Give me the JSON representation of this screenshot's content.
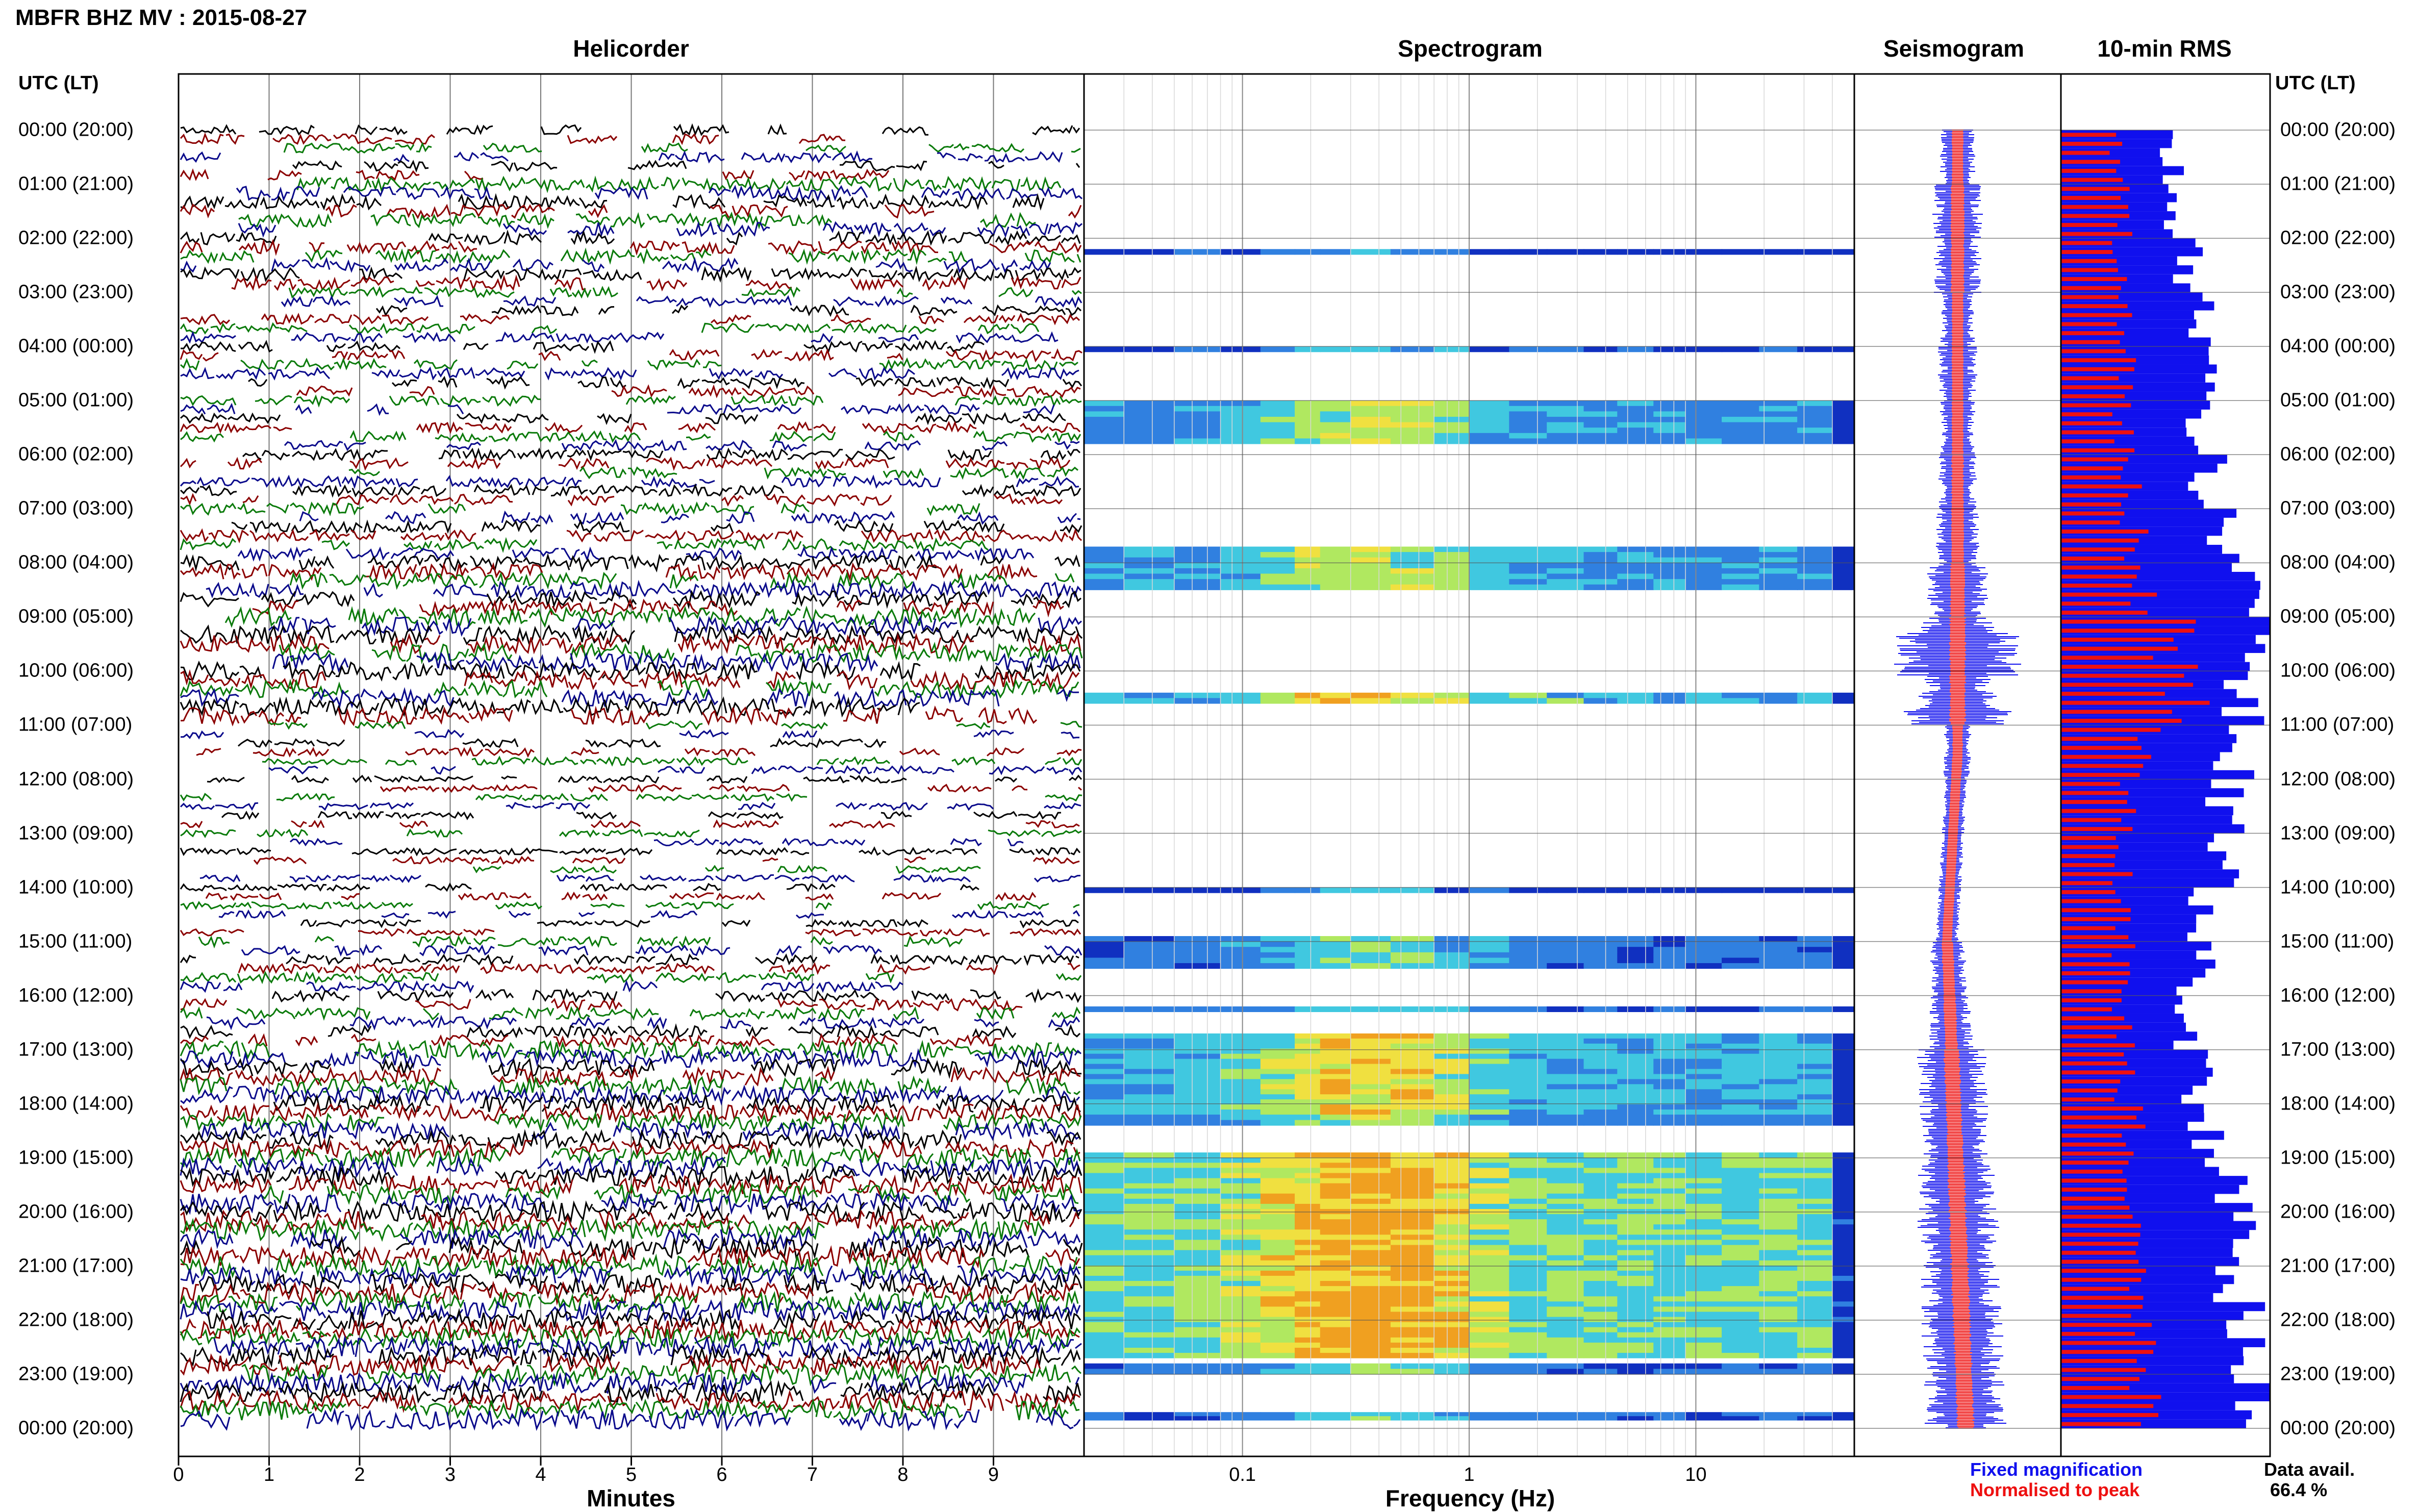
{
  "page": {
    "title": "MBFR BHZ MV : 2015-08-27",
    "utc_header_left": "UTC (LT)",
    "utc_header_right": "UTC (LT)"
  },
  "panels": {
    "helicorder": {
      "title": "Helicorder",
      "xlabel": "Minutes",
      "ticks": [
        "0",
        "1",
        "2",
        "3",
        "4",
        "5",
        "6",
        "7",
        "8",
        "9"
      ]
    },
    "spectrogram": {
      "title": "Spectrogram",
      "xlabel": "Frequency (Hz)",
      "ticks": [
        "0.1",
        "1",
        "10"
      ]
    },
    "seismogram": {
      "title": "Seismogram"
    },
    "rms": {
      "title": "10-min RMS"
    }
  },
  "hour_labels": [
    "00:00 (20:00)",
    "01:00 (21:00)",
    "02:00 (22:00)",
    "03:00 (23:00)",
    "04:00 (00:00)",
    "05:00 (01:00)",
    "06:00 (02:00)",
    "07:00 (03:00)",
    "08:00 (04:00)",
    "09:00 (05:00)",
    "10:00 (06:00)",
    "11:00 (07:00)",
    "12:00 (08:00)",
    "13:00 (09:00)",
    "14:00 (10:00)",
    "15:00 (11:00)",
    "16:00 (12:00)",
    "17:00 (13:00)",
    "18:00 (14:00)",
    "19:00 (15:00)",
    "20:00 (16:00)",
    "21:00 (17:00)",
    "22:00 (18:00)",
    "23:00 (19:00)",
    "00:00 (20:00)"
  ],
  "legend": {
    "fixed": "Fixed magnification",
    "normalised": "Normalised to peak",
    "fixed_color": "#1010ee",
    "normalised_color": "#ee1010"
  },
  "data_avail": {
    "label": "Data avail.",
    "value": "66.4 %"
  },
  "colors": {
    "helicorder_traces": [
      "#000000",
      "#8b0000",
      "#0a7a0a",
      "#0a0a8b"
    ],
    "rms_fixed": "#1010ee",
    "rms_normalised": "#ee1010"
  },
  "chart_data": [
    {
      "type": "line",
      "title": "Helicorder",
      "xlabel": "Minutes",
      "xlim": [
        0,
        10
      ],
      "y": "UTC hours 00:00 to 24:00",
      "activity_by_hour": [
        0.3,
        0.5,
        0.45,
        0.3,
        0.35,
        0.3,
        0.35,
        0.4,
        0.6,
        0.75,
        0.7,
        0.2,
        0.15,
        0.15,
        0.15,
        0.3,
        0.4,
        0.7,
        0.7,
        0.8,
        0.85,
        0.85,
        0.85,
        0.85
      ]
    },
    {
      "type": "heatmap",
      "title": "Spectrogram",
      "xlabel": "Frequency (Hz)",
      "xscale": "log",
      "xlim": [
        0.02,
        50
      ],
      "y": "UTC hours 00:00 to 24:00"
    },
    {
      "type": "bar",
      "title": "10-min RMS",
      "orientation": "horizontal",
      "series": [
        {
          "name": "Fixed magnification",
          "values": [
            0.55,
            0.55,
            0.6,
            0.65,
            0.65,
            0.7,
            0.7,
            0.75,
            0.85,
            0.95,
            0.9,
            0.85,
            0.8,
            0.75,
            0.65,
            0.65,
            0.6,
            0.65,
            0.7,
            0.8,
            0.85,
            0.85,
            0.9,
            0.9
          ]
        },
        {
          "name": "Normalised to peak",
          "values": [
            0.25,
            0.3,
            0.3,
            0.3,
            0.3,
            0.3,
            0.35,
            0.35,
            0.4,
            0.55,
            0.6,
            0.4,
            0.35,
            0.3,
            0.3,
            0.3,
            0.3,
            0.3,
            0.35,
            0.35,
            0.4,
            0.4,
            0.4,
            0.4
          ]
        }
      ]
    }
  ]
}
